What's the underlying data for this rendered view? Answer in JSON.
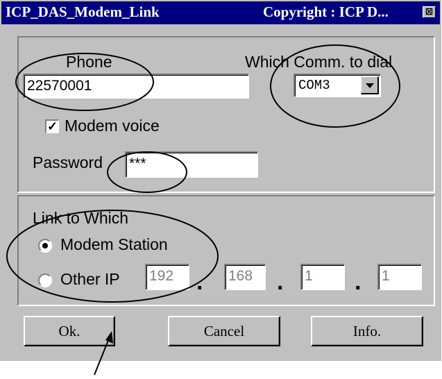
{
  "window": {
    "title": "ICP_DAS_Modem_Link",
    "copyright": "Copyright : ICP D...",
    "close_glyph": "⊠"
  },
  "dial_group": {
    "phone_label": "Phone",
    "phone_value": "22570001",
    "comm_label": "Which Comm. to dial",
    "comm_value": "COM3",
    "modem_voice_label": "Modem voice",
    "modem_voice_checked": true,
    "check_glyph": "✓",
    "password_label": "Password",
    "password_value": "***"
  },
  "link_group": {
    "label": "Link to Which",
    "option_modem_station": "Modem Station",
    "option_other_ip": "Other IP",
    "selected": "modem_station",
    "ip": [
      "192",
      "168",
      "1",
      "1"
    ],
    "ip_separator": "."
  },
  "buttons": {
    "ok": "Ok.",
    "cancel": "Cancel",
    "info": "Info."
  }
}
